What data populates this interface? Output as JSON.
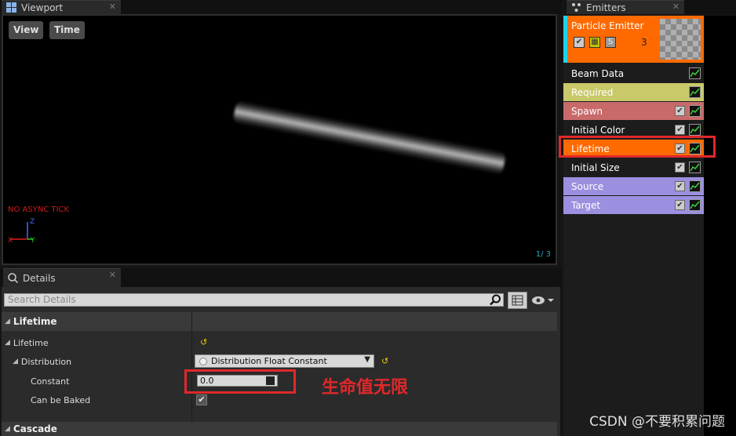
{
  "viewport": {
    "tab_label": "Viewport",
    "view_button": "View",
    "time_button": "Time",
    "no_async_tick": "NO ASYNC TICK",
    "axis": {
      "z": "Z",
      "x": "X",
      "y": "Y"
    },
    "counter": "1/  3"
  },
  "details": {
    "tab_label": "Details",
    "search_placeholder": "Search Details",
    "category_lifetime": "Lifetime",
    "prop_lifetime": "Lifetime",
    "prop_distribution": "Distribution",
    "distribution_value": "Distribution Float Constant",
    "prop_constant": "Constant",
    "constant_value": "0.0",
    "prop_can_be_baked": "Can be Baked",
    "can_be_baked_checked": true,
    "category_cascade": "Cascade",
    "reset_glyph": "↺"
  },
  "annotation": "生命值无限",
  "emitters": {
    "tab_label": "Emitters",
    "emitter": {
      "name": "Particle Emitter",
      "count": "3",
      "solo_label": "S"
    },
    "modules": [
      {
        "label": "Beam Data",
        "color": "#1c1c1c",
        "has_checkbox": false
      },
      {
        "label": "Required",
        "color": "#c9c96a",
        "has_checkbox": false
      },
      {
        "label": "Spawn",
        "color": "#c96a6a",
        "has_checkbox": true
      },
      {
        "label": "Initial Color",
        "color": "#1c1c1c",
        "has_checkbox": true
      },
      {
        "label": "Lifetime",
        "color": "#ff6a00",
        "has_checkbox": true
      },
      {
        "label": "Initial Size",
        "color": "#1c1c1c",
        "has_checkbox": true
      },
      {
        "label": "Source",
        "color": "#9b8fe0",
        "has_checkbox": true
      },
      {
        "label": "Target",
        "color": "#9b8fe0",
        "has_checkbox": true
      }
    ]
  },
  "watermark": "CSDN @不要积累问题",
  "colors": {
    "highlight_red": "#e0282b",
    "selected_orange": "#ff6a00"
  }
}
